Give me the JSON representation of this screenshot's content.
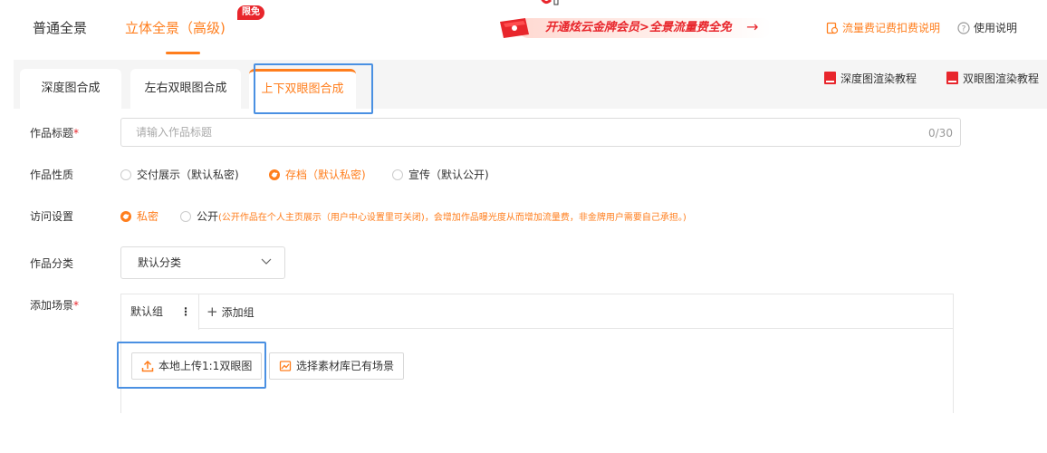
{
  "header": {
    "mode_tabs": [
      "普通全景",
      "立体全景（高级)"
    ],
    "free_badge": "限免",
    "promo_text": "开通炫云金牌会员>全景流量费全免",
    "promo_arrow": "→",
    "links": [
      "流量费记费扣费说明",
      "使用说明"
    ]
  },
  "sub_tabs": [
    "深度图合成",
    "左右双眼图合成",
    "上下双眼图合成"
  ],
  "tutorials": [
    "深度图渲染教程",
    "双眼图渲染教程"
  ],
  "form": {
    "title_label": "作品标题",
    "title_placeholder": "请输入作品标题",
    "title_value": "",
    "title_counter": "0/30",
    "nature_label": "作品性质",
    "nature_options": [
      "交付展示（默认私密)",
      "存档（默认私密)",
      "宣传（默认公开)"
    ],
    "nature_selected": 1,
    "access_label": "访问设置",
    "access_options": [
      "私密",
      "公开"
    ],
    "access_selected": 0,
    "access_warning": "(公开作品在个人主页展示（用户中心设置里可关闭)，会增加作品曝光度从而增加流量费，非金牌用户需要自己承担。)",
    "category_label": "作品分类",
    "category_value": "默认分类",
    "scene_label": "添加场景",
    "required_mark": "*",
    "group_tab": "默认组",
    "group_dots": "⋮",
    "add_group": "添加组",
    "upload_button": "本地上传1:1双眼图",
    "library_button": "选择素材库已有场景"
  },
  "colors": {
    "accent": "#ff7e1d",
    "red": "#e8262c",
    "highlight": "#4a90e2"
  }
}
